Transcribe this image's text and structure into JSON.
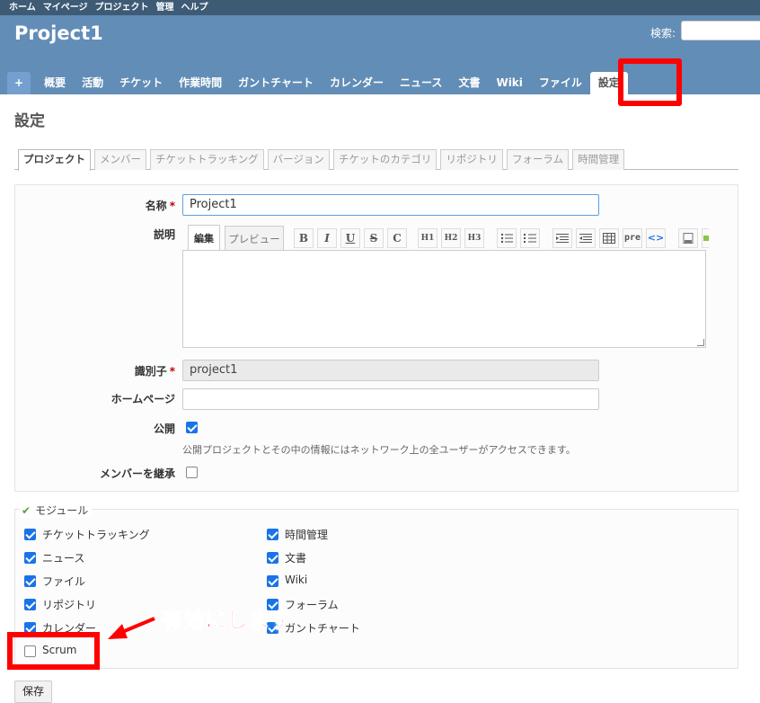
{
  "top_menu": {
    "items": [
      "ホーム",
      "マイページ",
      "プロジェクト",
      "管理",
      "ヘルプ"
    ]
  },
  "header": {
    "title": "Project1",
    "search_label": "検索:"
  },
  "main_menu": {
    "new_label": "+",
    "items": [
      "概要",
      "活動",
      "チケット",
      "作業時間",
      "ガントチャート",
      "カレンダー",
      "ニュース",
      "文書",
      "Wiki",
      "ファイル",
      "設定"
    ]
  },
  "page": {
    "heading": "設定"
  },
  "tabs": [
    "プロジェクト",
    "メンバー",
    "チケットトラッキング",
    "バージョン",
    "チケットのカテゴリ",
    "リポジトリ",
    "フォーラム",
    "時間管理"
  ],
  "form": {
    "name_label": "名称",
    "required_mark": "*",
    "name_value": "Project1",
    "description_label": "説明",
    "edit_tab": "編集",
    "preview_tab": "プレビュー",
    "toolbar": [
      "B",
      "I",
      "U",
      "S",
      "C",
      "H1",
      "H2",
      "H3",
      "pre"
    ],
    "identifier_label": "識別子",
    "identifier_value": "project1",
    "homepage_label": "ホームページ",
    "homepage_value": "",
    "public_label": "公開",
    "public_checked": true,
    "public_note": "公開プロジェクトとその中の情報にはネットワーク上の全ユーザーがアクセスできます。",
    "inherit_label": "メンバーを継承",
    "inherit_checked": false
  },
  "modules": {
    "legend": "モジュール",
    "left": [
      {
        "label": "チケットトラッキング",
        "checked": true
      },
      {
        "label": "ニュース",
        "checked": true
      },
      {
        "label": "ファイル",
        "checked": true
      },
      {
        "label": "リポジトリ",
        "checked": true
      },
      {
        "label": "カレンダー",
        "checked": true
      },
      {
        "label": "Scrum",
        "checked": false
      }
    ],
    "right": [
      {
        "label": "時間管理",
        "checked": true
      },
      {
        "label": "文書",
        "checked": true
      },
      {
        "label": "Wiki",
        "checked": true
      },
      {
        "label": "フォーラム",
        "checked": true
      },
      {
        "label": "ガントチャート",
        "checked": true
      }
    ]
  },
  "annotation": {
    "text": "有効にします",
    "color": "#ff0000"
  },
  "save_label": "保存"
}
